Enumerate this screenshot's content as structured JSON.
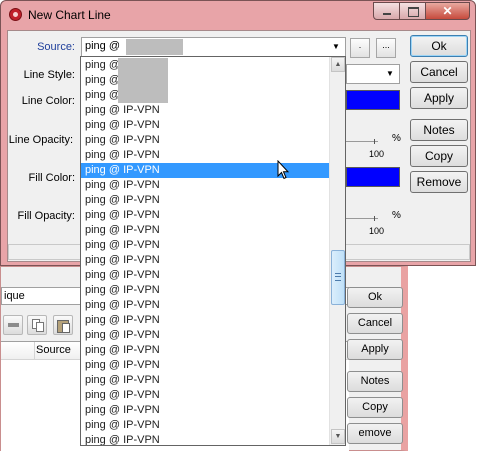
{
  "background_window": {
    "field_value": "ique",
    "column_source": "Source",
    "buttons": [
      "Ok",
      "Cancel",
      "Apply",
      "Notes",
      "Copy",
      "emove"
    ]
  },
  "dialog": {
    "title": "New Chart Line",
    "labels": {
      "source": "Source:",
      "line_style": "Line Style:",
      "line_color": "Line Color:",
      "line_opacity": "Line Opacity:",
      "fill_color": "Fill Color:",
      "fill_opacity": "Fill Opacity:"
    },
    "source_value": "ping @",
    "small_buttons": [
      ".",
      "..."
    ],
    "buttons": [
      "Ok",
      "Cancel",
      "Apply",
      "Notes",
      "Copy",
      "Remove"
    ],
    "line_color": "#0000ff",
    "fill_color": "#0000ff",
    "line_opacity_max": "100",
    "fill_opacity_max": "100",
    "percent_sign": "%"
  },
  "dropdown": {
    "selected_index": 7,
    "items": [
      "ping @",
      "ping @",
      "ping @",
      "ping @ IP-VPN",
      "ping @ IP-VPN",
      "ping @ IP-VPN",
      "ping @ IP-VPN",
      "ping @ IP-VPN",
      "ping @ IP-VPN",
      "ping @ IP-VPN",
      "ping @ IP-VPN",
      "ping @ IP-VPN",
      "ping @ IP-VPN",
      "ping @ IP-VPN",
      "ping @ IP-VPN",
      "ping @ IP-VPN",
      "ping @ IP-VPN",
      "ping @ IP-VPN",
      "ping @ IP-VPN",
      "ping @ IP-VPN",
      "ping @ IP-VPN",
      "ping @ IP-VPN",
      "ping @ IP-VPN",
      "ping @ IP-VPN",
      "ping @ IP-VPN",
      "ping @ IP-VPN"
    ]
  }
}
